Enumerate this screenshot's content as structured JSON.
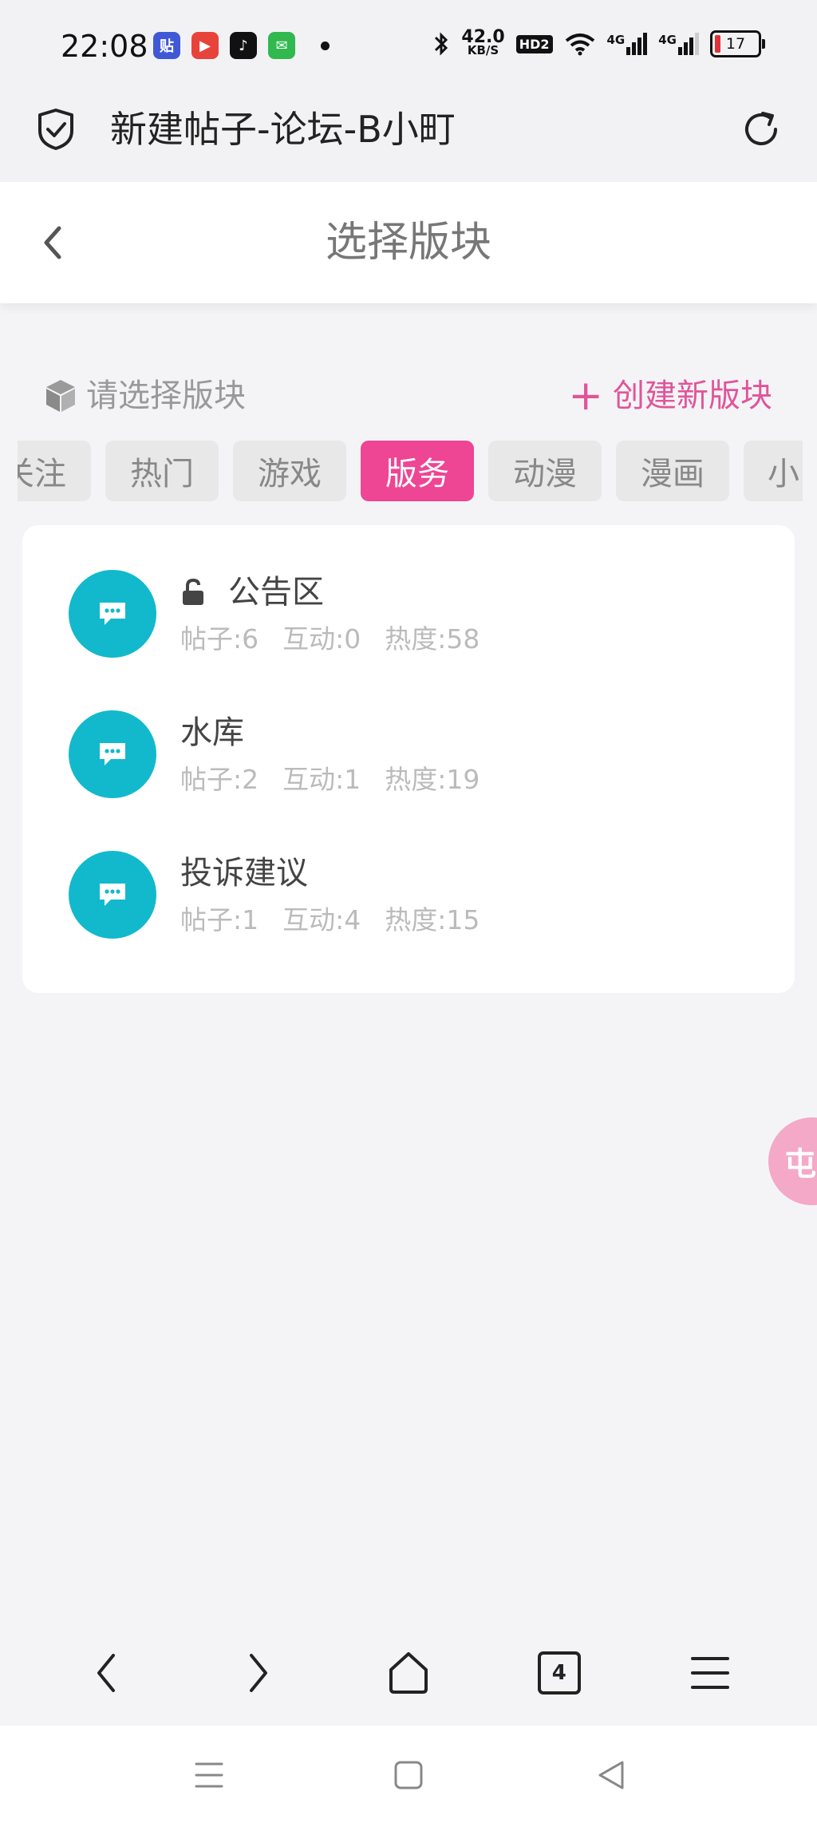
{
  "status_bar": {
    "time": "22:08",
    "apps": [
      {
        "icon": "tieba-app-icon",
        "glyph": "贴",
        "color": "#3f59d6"
      },
      {
        "icon": "video-app-icon",
        "glyph": "▶",
        "color": "#e8433a"
      },
      {
        "icon": "tiktok-app-icon",
        "glyph": "♪",
        "color": "#111111"
      },
      {
        "icon": "messages-app-icon",
        "glyph": "✉",
        "color": "#31b84e"
      }
    ],
    "speed_value": "42.0",
    "speed_unit": "KB/S",
    "hd_label": "HD2",
    "network_1": "4G",
    "network_2": "4G",
    "battery": "17"
  },
  "browser": {
    "page_title": "新建帖子-论坛-B小町",
    "tab_count": "4"
  },
  "header": {
    "title": "选择版块"
  },
  "section": {
    "label": "请选择版块",
    "create_label": "创建新版块"
  },
  "tabs": [
    {
      "label": "关注"
    },
    {
      "label": "热门"
    },
    {
      "label": "游戏"
    },
    {
      "label": "版务"
    },
    {
      "label": "动漫"
    },
    {
      "label": "漫画"
    },
    {
      "label": "小"
    }
  ],
  "active_tab": "版务",
  "boards": [
    {
      "name": "公告区",
      "locked": true,
      "posts": "帖子:6",
      "interactions": "互动:0",
      "heat": "热度:58"
    },
    {
      "name": "水库",
      "locked": false,
      "posts": "帖子:2",
      "interactions": "互动:1",
      "heat": "热度:19"
    },
    {
      "name": "投诉建议",
      "locked": false,
      "posts": "帖子:1",
      "interactions": "互动:4",
      "heat": "热度:15"
    }
  ],
  "float_bubble": {
    "label": "屯"
  },
  "colors": {
    "accent": "#ee4595",
    "create_link": "#e0559a",
    "board_avatar": "#12b9cc"
  }
}
